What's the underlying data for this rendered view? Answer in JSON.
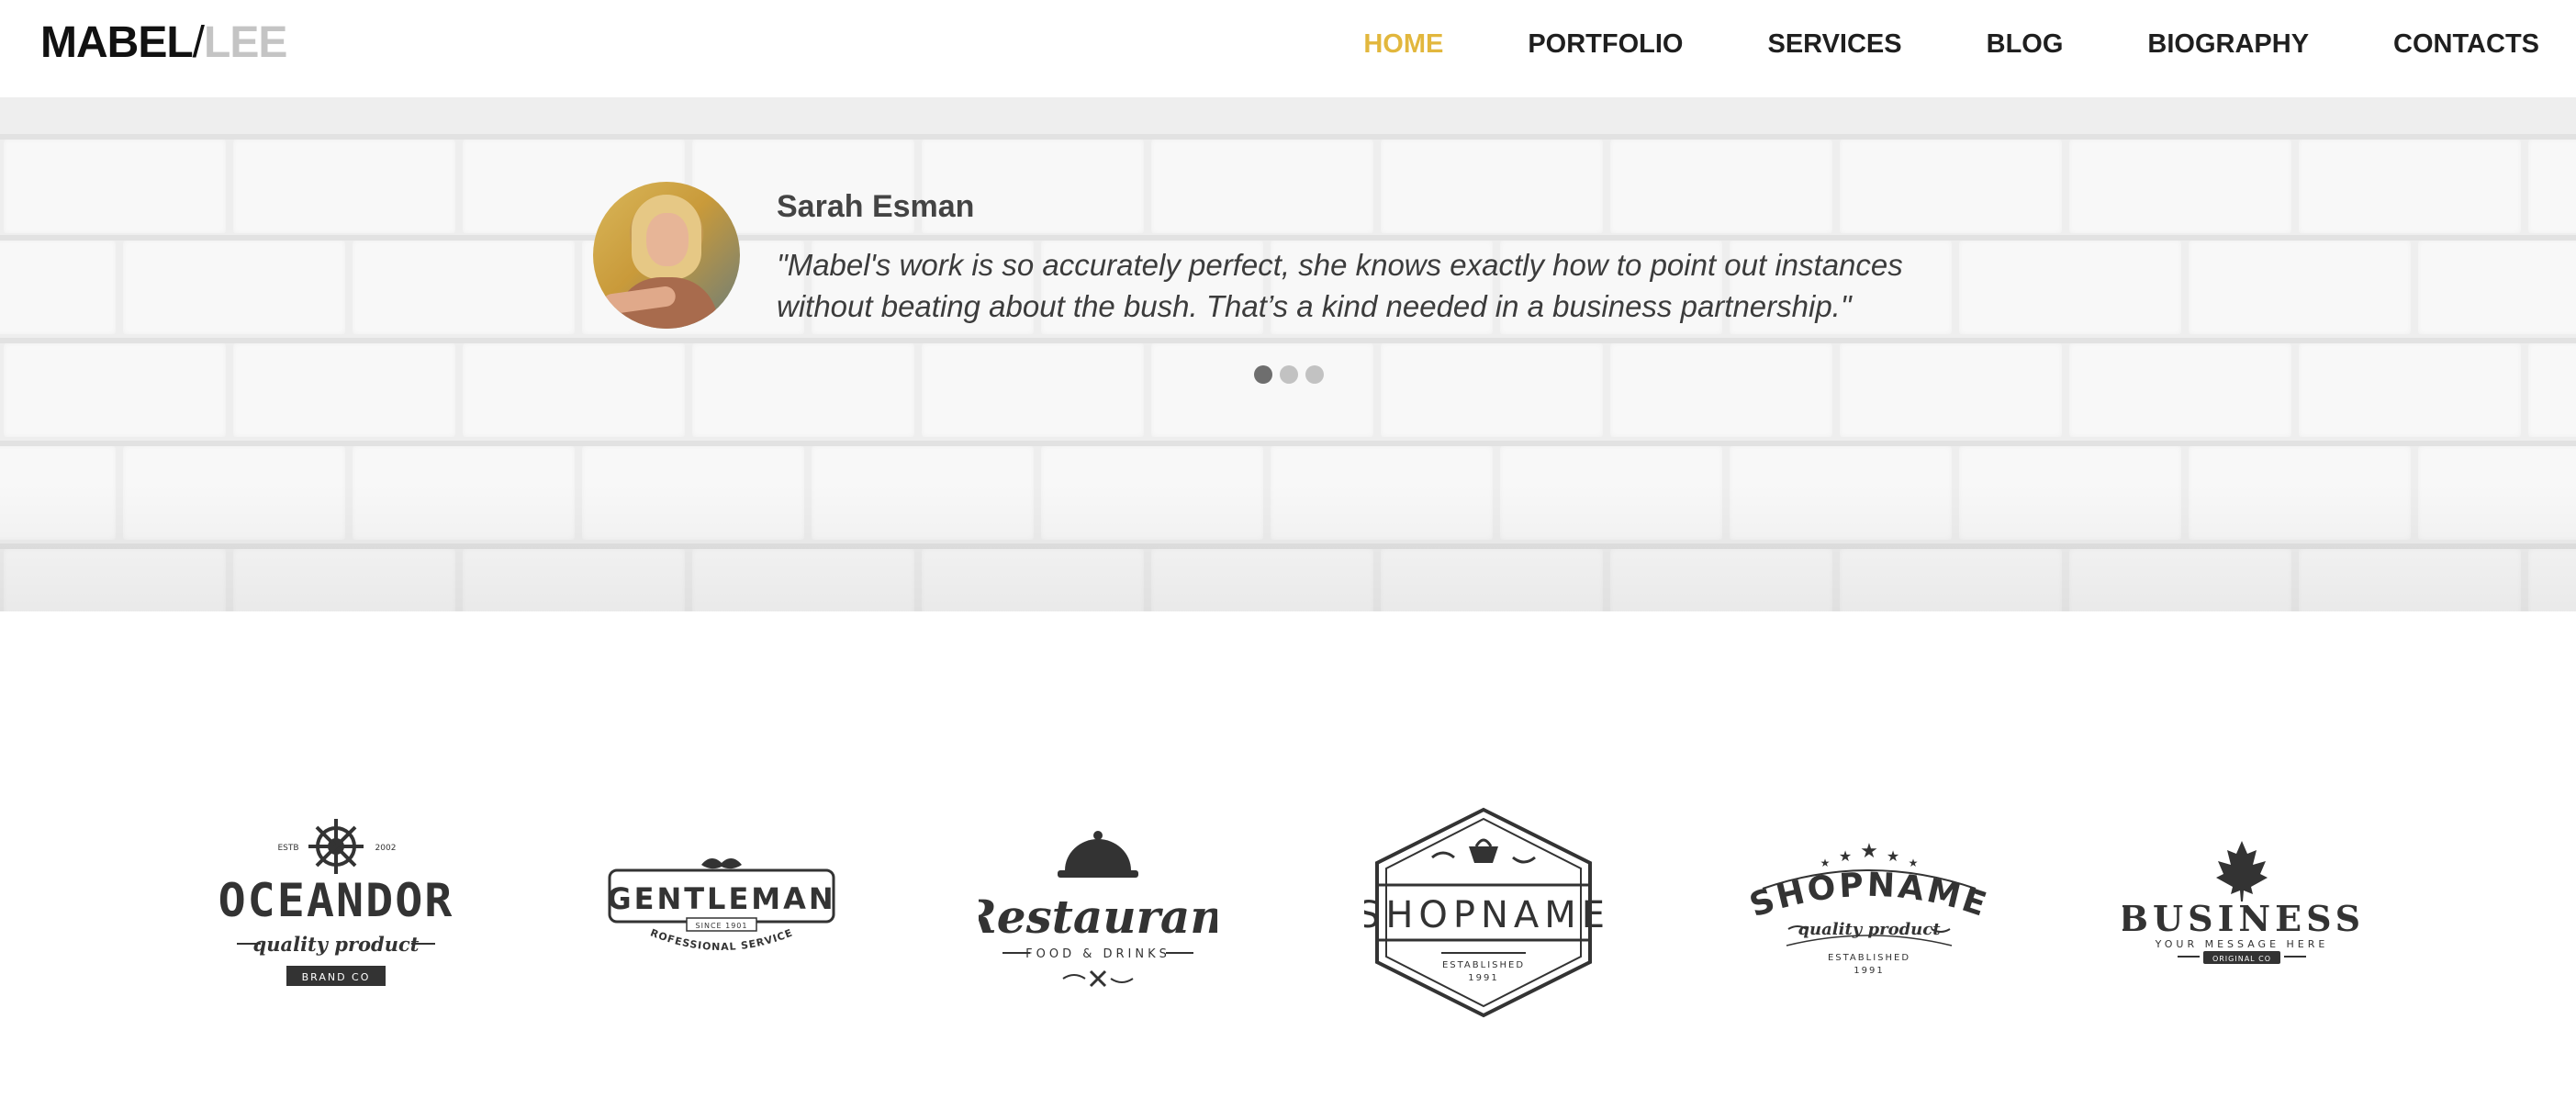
{
  "header": {
    "logo": {
      "first": "MABEL",
      "slash": "/",
      "second": "LEE"
    },
    "nav": [
      {
        "label": "HOME",
        "active": true
      },
      {
        "label": "PORTFOLIO",
        "active": false
      },
      {
        "label": "SERVICES",
        "active": false
      },
      {
        "label": "BLOG",
        "active": false
      },
      {
        "label": "BIOGRAPHY",
        "active": false
      },
      {
        "label": "CONTACTS",
        "active": false
      }
    ]
  },
  "testimonial": {
    "name": "Sarah Esman",
    "quote": "\"Mabel's work is so accurately perfect, she knows exactly how to point out instances without beating about the bush. That’s a kind needed in a business partnership.\"",
    "slides_total": 3,
    "active_slide": 1
  },
  "colors": {
    "accent": "#e2b73d",
    "logo_gray": "#c4c4c4",
    "dot_active": "#6e6e6e",
    "dot_inactive": "#c2c2c2",
    "badge_ink": "#333333"
  },
  "brands": [
    {
      "icon": "ship-wheel-icon",
      "estb": "ESTB",
      "year": "2002",
      "name": "OCEANDOR",
      "tagline": "quality product",
      "footer": "BRAND CO"
    },
    {
      "icon": "mustache-icon",
      "name": "GENTLEMAN",
      "since": "SINCE 1901",
      "tagline": "PROFESSIONAL SERVICES"
    },
    {
      "icon": "cloche-icon",
      "name": "Restaurant",
      "tagline": "FOOD & DRINKS",
      "footer_icon": "fork-knife-icon"
    },
    {
      "icon": "basket-icon",
      "name": "SHOPNAME",
      "established": "ESTABLISHED",
      "year": "1991"
    },
    {
      "icon": "stars-icon",
      "name": "SHOPNAME",
      "tagline": "quality product",
      "established": "ESTABLISHED",
      "year": "1991"
    },
    {
      "icon": "maple-leaf-icon",
      "name": "BUSINESS",
      "tagline": "YOUR MESSAGE HERE",
      "footer": "ORIGINAL CO"
    }
  ]
}
